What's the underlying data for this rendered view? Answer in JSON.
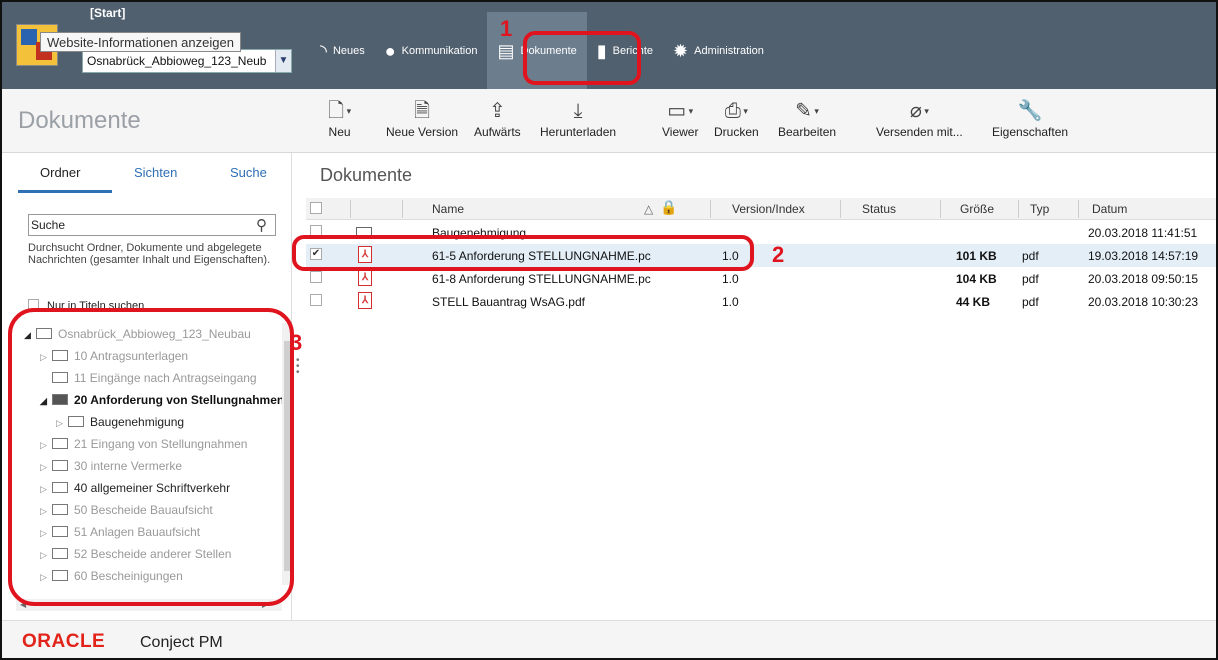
{
  "header": {
    "start_label": "[Start]",
    "tooltip": "Website-Informationen anzeigen",
    "project_select": "Osnabrück_Abbioweg_123_Neub",
    "nav": [
      {
        "label": "Neues",
        "icon": "rss-icon"
      },
      {
        "label": "Kommunikation",
        "icon": "speech-bubble-icon"
      },
      {
        "label": "Dokumente",
        "icon": "documents-icon",
        "active": true
      },
      {
        "label": "Berichte",
        "icon": "bar-chart-icon"
      },
      {
        "label": "Administration",
        "icon": "gear-icon"
      }
    ]
  },
  "annotations": [
    "1",
    "2",
    "3"
  ],
  "toolbar": {
    "section_title": "Dokumente",
    "tools": [
      {
        "label": "Neu",
        "icon": "new-document-icon",
        "glyph": "🗋",
        "caret": true
      },
      {
        "label": "Neue Version",
        "icon": "new-version-icon",
        "glyph": "🗎",
        "caret": false
      },
      {
        "label": "Aufwärts",
        "icon": "folder-up-icon",
        "glyph": "⇪",
        "caret": false
      },
      {
        "label": "Herunterladen",
        "icon": "download-icon",
        "glyph": "⤓",
        "caret": false
      },
      {
        "label": "Viewer",
        "icon": "viewer-icon",
        "glyph": "▭",
        "caret": true
      },
      {
        "label": "Drucken",
        "icon": "printer-icon",
        "glyph": "⎙",
        "caret": true
      },
      {
        "label": "Bearbeiten",
        "icon": "pencil-icon",
        "glyph": "✎",
        "caret": true
      },
      {
        "label": "Versenden mit...",
        "icon": "paperclip-icon",
        "glyph": "⌀",
        "caret": true
      },
      {
        "label": "Eigenschaften",
        "icon": "wrench-icon",
        "glyph": "🔧",
        "caret": false
      }
    ]
  },
  "left": {
    "tabs": [
      "Ordner",
      "Sichten",
      "Suche"
    ],
    "search_value": "Suche",
    "search_hint": "Durchsucht Ordner, Dokumente und abgelegete Nachrichten (gesamter Inhalt und Eigenschaften).",
    "title_only": "Nur in Titeln suchen",
    "tree": [
      {
        "label": "Osnabrück_Abbioweg_123_Neubau",
        "indent": 0,
        "expander": "◢",
        "style": "root"
      },
      {
        "label": "10 Antragsunterlagen",
        "indent": 1,
        "expander": "▷",
        "style": "grey"
      },
      {
        "label": "11 Eingänge nach Antragseingang",
        "indent": 1,
        "expander": "",
        "style": "grey"
      },
      {
        "label": "20 Anforderung von Stellungnahmen",
        "indent": 1,
        "expander": "◢",
        "style": "bold"
      },
      {
        "label": "Baugenehmigung",
        "indent": 2,
        "expander": "▷",
        "style": "dark"
      },
      {
        "label": "21 Eingang von Stellungnahmen",
        "indent": 1,
        "expander": "▷",
        "style": "grey"
      },
      {
        "label": "30 interne Vermerke",
        "indent": 1,
        "expander": "▷",
        "style": "grey"
      },
      {
        "label": "40 allgemeiner Schriftverkehr",
        "indent": 1,
        "expander": "▷",
        "style": "dark"
      },
      {
        "label": "50 Bescheide Bauaufsicht",
        "indent": 1,
        "expander": "▷",
        "style": "grey"
      },
      {
        "label": "51 Anlagen Bauaufsicht",
        "indent": 1,
        "expander": "▷",
        "style": "grey"
      },
      {
        "label": "52 Bescheide anderer Stellen",
        "indent": 1,
        "expander": "▷",
        "style": "grey"
      },
      {
        "label": "60 Bescheinigungen",
        "indent": 1,
        "expander": "▷",
        "style": "grey"
      }
    ]
  },
  "main": {
    "title": "Dokumente",
    "columns": [
      "Name",
      "Version/Index",
      "Status",
      "Größe",
      "Typ",
      "Datum"
    ],
    "sort_indicator": "△",
    "rows": [
      {
        "kind": "folder",
        "name": "Baugenehmigung",
        "version": "",
        "status": "",
        "size": "",
        "type": "",
        "date": "20.03.2018 11:41:51",
        "checked": false
      },
      {
        "kind": "pdf",
        "name": "61-5 Anforderung STELLUNGNAHME.pc",
        "version": "1.0",
        "status": "",
        "size": "101 KB",
        "type": "pdf",
        "date": "19.03.2018 14:57:19",
        "checked": true
      },
      {
        "kind": "pdf",
        "name": "61-8 Anforderung STELLUNGNAHME.pc",
        "version": "1.0",
        "status": "",
        "size": "104 KB",
        "type": "pdf",
        "date": "20.03.2018 09:50:15",
        "checked": false
      },
      {
        "kind": "pdf",
        "name": "STELL Bauantrag WsAG.pdf",
        "version": "1.0",
        "status": "",
        "size": "44 KB",
        "type": "pdf",
        "date": "20.03.2018 10:30:23",
        "checked": false
      }
    ]
  },
  "footer": {
    "brand": "ORACLE",
    "product": "Conject PM"
  },
  "colors": {
    "header_bg": "#51606f",
    "annotation": "#e0141e",
    "link": "#2f6fb4",
    "oracle_red": "#e2231a"
  }
}
